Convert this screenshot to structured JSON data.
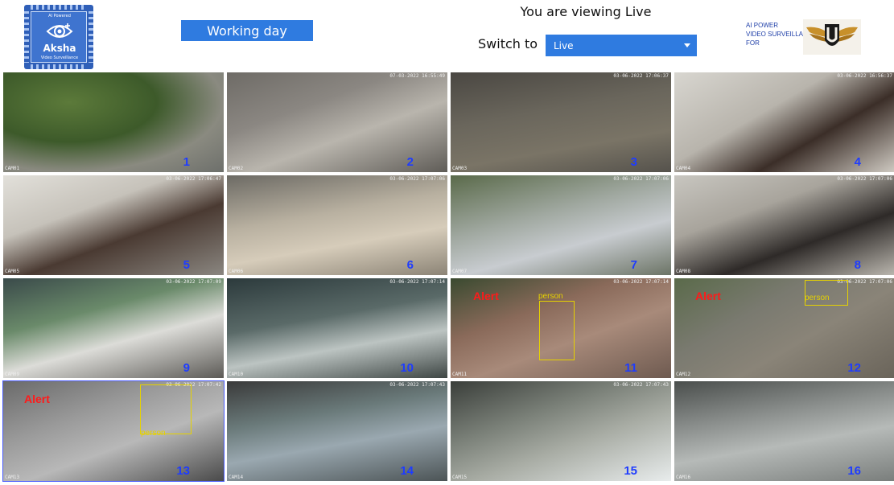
{
  "header": {
    "logo": {
      "tag": "AI Powered",
      "name": "Aksha",
      "subtitle": "Video Surveillance"
    },
    "working_day_label": "Working day",
    "viewing_text": "You are viewing Live",
    "switch_label": "Switch to",
    "switch_select": {
      "selected": "Live"
    },
    "brand_text": [
      "AI POWER",
      "VIDEO SURVEILLANCE",
      "FOR"
    ]
  },
  "cameras": [
    {
      "id": "CAM01",
      "number": "1",
      "timestamp": "",
      "alert": "",
      "detection": ""
    },
    {
      "id": "CAM02",
      "number": "2",
      "timestamp": "07-03-2022 16:55:49",
      "alert": "",
      "detection": ""
    },
    {
      "id": "CAM03",
      "number": "3",
      "timestamp": "03-06-2022 17:06:37",
      "alert": "",
      "detection": ""
    },
    {
      "id": "CAM04",
      "number": "4",
      "timestamp": "03-06-2022 16:56:37",
      "alert": "",
      "detection": ""
    },
    {
      "id": "CAM05",
      "number": "5",
      "timestamp": "03-06-2022 17:06:47",
      "alert": "",
      "detection": ""
    },
    {
      "id": "CAM06",
      "number": "6",
      "timestamp": "03-06-2022 17:07:06",
      "alert": "",
      "detection": ""
    },
    {
      "id": "CAM07",
      "number": "7",
      "timestamp": "03-06-2022 17:07:06",
      "alert": "",
      "detection": ""
    },
    {
      "id": "CAM08",
      "number": "8",
      "timestamp": "03-06-2022 17:07:06",
      "alert": "",
      "detection": ""
    },
    {
      "id": "CAM09",
      "number": "9",
      "timestamp": "03-06-2022 17:07:09",
      "alert": "",
      "detection": ""
    },
    {
      "id": "CAM10",
      "number": "10",
      "timestamp": "03-06-2022 17:07:14",
      "alert": "",
      "detection": ""
    },
    {
      "id": "CAM11",
      "number": "11",
      "timestamp": "03-06-2022 17:07:14",
      "alert": "Alert",
      "detection": "person"
    },
    {
      "id": "CAM12",
      "number": "12",
      "timestamp": "03-06-2022 17:07:06",
      "alert": "Alert",
      "detection": "person"
    },
    {
      "id": "CAM13",
      "number": "13",
      "timestamp": "03-06-2022 17:07:42",
      "alert": "Alert",
      "detection": "person"
    },
    {
      "id": "CAM14",
      "number": "14",
      "timestamp": "03-06-2022 17:07:43",
      "alert": "",
      "detection": ""
    },
    {
      "id": "CAM15",
      "number": "15",
      "timestamp": "03-06-2022 17:07:43",
      "alert": "",
      "detection": ""
    },
    {
      "id": "CAM16",
      "number": "16",
      "timestamp": "",
      "alert": "",
      "detection": ""
    }
  ],
  "colors": {
    "accent": "#2f7be0",
    "alert": "#ff1a1a",
    "detection_box": "#e6d200",
    "camera_number": "#1e3cff"
  }
}
